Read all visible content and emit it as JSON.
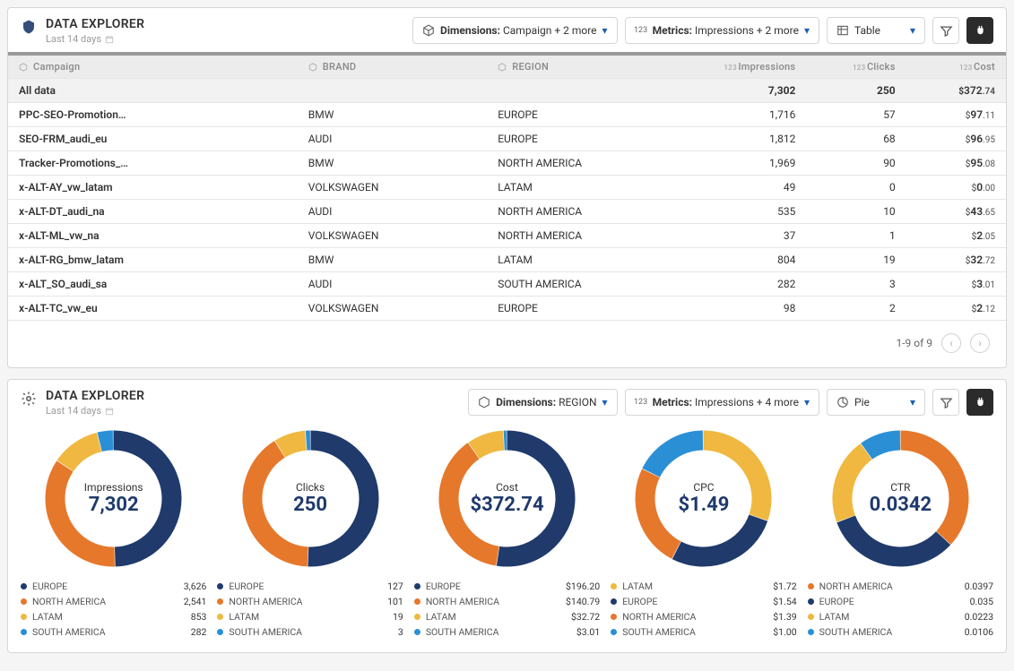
{
  "colors": {
    "europe": "#1f3a6b",
    "northamerica": "#e6782b",
    "latam": "#f0b840",
    "southamerica": "#2b8fd6"
  },
  "table": {
    "title": "DATA EXPLORER",
    "subtitle": "Last 14 days",
    "controls": {
      "dimensions_label": "Dimensions:",
      "dimensions_value": "Campaign + 2 more",
      "metrics_label": "Metrics:",
      "metrics_value": "Impressions + 2 more",
      "view": "Table"
    },
    "columns": [
      "Campaign",
      "BRAND",
      "REGION",
      "Impressions",
      "Clicks",
      "Cost"
    ],
    "totalRow": {
      "label": "All data",
      "impressions": "7,302",
      "clicks": "250",
      "cost_prefix": "$",
      "cost_major": "372",
      "cost_minor": ".74"
    },
    "rows": [
      {
        "campaign": "PPC-SEO-Promotion…",
        "brand": "BMW",
        "region": "EUROPE",
        "impressions": "1,716",
        "clicks": "57",
        "cost_major": "97",
        "cost_minor": ".11"
      },
      {
        "campaign": "SEO-FRM_audi_eu",
        "brand": "AUDI",
        "region": "EUROPE",
        "impressions": "1,812",
        "clicks": "68",
        "cost_major": "96",
        "cost_minor": ".95"
      },
      {
        "campaign": "Tracker-Promotions_…",
        "brand": "BMW",
        "region": "NORTH AMERICA",
        "impressions": "1,969",
        "clicks": "90",
        "cost_major": "95",
        "cost_minor": ".08"
      },
      {
        "campaign": "x-ALT-AY_vw_latam",
        "brand": "VOLKSWAGEN",
        "region": "LATAM",
        "impressions": "49",
        "clicks": "0",
        "cost_major": "0",
        "cost_minor": ".00"
      },
      {
        "campaign": "x-ALT-DT_audi_na",
        "brand": "AUDI",
        "region": "NORTH AMERICA",
        "impressions": "535",
        "clicks": "10",
        "cost_major": "43",
        "cost_minor": ".65"
      },
      {
        "campaign": "x-ALT-ML_vw_na",
        "brand": "VOLKSWAGEN",
        "region": "NORTH AMERICA",
        "impressions": "37",
        "clicks": "1",
        "cost_major": "2",
        "cost_minor": ".05"
      },
      {
        "campaign": "x-ALT-RG_bmw_latam",
        "brand": "BMW",
        "region": "LATAM",
        "impressions": "804",
        "clicks": "19",
        "cost_major": "32",
        "cost_minor": ".72"
      },
      {
        "campaign": "x-ALT_SO_audi_sa",
        "brand": "AUDI",
        "region": "SOUTH AMERICA",
        "impressions": "282",
        "clicks": "3",
        "cost_major": "3",
        "cost_minor": ".01"
      },
      {
        "campaign": "x-ALT-TC_vw_eu",
        "brand": "VOLKSWAGEN",
        "region": "EUROPE",
        "impressions": "98",
        "clicks": "2",
        "cost_major": "2",
        "cost_minor": ".12"
      }
    ],
    "pager": "1-9 of 9"
  },
  "charts": {
    "title": "DATA EXPLORER",
    "subtitle": "Last 14 days",
    "controls": {
      "dimensions_label": "Dimensions:",
      "dimensions_value": "REGION",
      "metrics_label": "Metrics:",
      "metrics_value": "Impressions + 4 more",
      "view": "Pie"
    },
    "donuts": [
      {
        "label": "Impressions",
        "value": "7,302",
        "sep": ",",
        "legend": [
          {
            "name": "EUROPE",
            "val": "3,626",
            "color": "europe"
          },
          {
            "name": "NORTH AMERICA",
            "val": "2,541",
            "color": "northamerica"
          },
          {
            "name": "LATAM",
            "val": "853",
            "color": "latam"
          },
          {
            "name": "SOUTH AMERICA",
            "val": "282",
            "color": "southamerica"
          }
        ],
        "slices": [
          {
            "color": "europe",
            "pct": 49.7
          },
          {
            "color": "northamerica",
            "pct": 34.8
          },
          {
            "color": "latam",
            "pct": 11.7
          },
          {
            "color": "southamerica",
            "pct": 3.8
          }
        ]
      },
      {
        "label": "Clicks",
        "value": "250",
        "legend": [
          {
            "name": "EUROPE",
            "val": "127",
            "color": "europe"
          },
          {
            "name": "NORTH AMERICA",
            "val": "101",
            "color": "northamerica"
          },
          {
            "name": "LATAM",
            "val": "19",
            "color": "latam"
          },
          {
            "name": "SOUTH AMERICA",
            "val": "3",
            "color": "southamerica"
          }
        ],
        "slices": [
          {
            "color": "europe",
            "pct": 50.8
          },
          {
            "color": "northamerica",
            "pct": 40.4
          },
          {
            "color": "latam",
            "pct": 7.6
          },
          {
            "color": "southamerica",
            "pct": 1.2
          }
        ]
      },
      {
        "label": "Cost",
        "value": "$372.74",
        "legend": [
          {
            "name": "EUROPE",
            "val": "$196.20",
            "color": "europe"
          },
          {
            "name": "NORTH AMERICA",
            "val": "$140.79",
            "color": "northamerica"
          },
          {
            "name": "LATAM",
            "val": "$32.72",
            "color": "latam"
          },
          {
            "name": "SOUTH AMERICA",
            "val": "$3.01",
            "color": "southamerica"
          }
        ],
        "slices": [
          {
            "color": "europe",
            "pct": 52.6
          },
          {
            "color": "northamerica",
            "pct": 37.8
          },
          {
            "color": "latam",
            "pct": 8.8
          },
          {
            "color": "southamerica",
            "pct": 0.8
          }
        ]
      },
      {
        "label": "CPC",
        "value": "$1.49",
        "legend": [
          {
            "name": "LATAM",
            "val": "$1.72",
            "color": "latam"
          },
          {
            "name": "EUROPE",
            "val": "$1.54",
            "color": "europe"
          },
          {
            "name": "NORTH AMERICA",
            "val": "$1.39",
            "color": "northamerica"
          },
          {
            "name": "SOUTH AMERICA",
            "val": "$1.00",
            "color": "southamerica"
          }
        ],
        "slices": [
          {
            "color": "latam",
            "pct": 30.4
          },
          {
            "color": "europe",
            "pct": 27.3
          },
          {
            "color": "northamerica",
            "pct": 24.6
          },
          {
            "color": "southamerica",
            "pct": 17.7
          }
        ]
      },
      {
        "label": "CTR",
        "value": "0.0342",
        "legend": [
          {
            "name": "NORTH AMERICA",
            "val": "0.0397",
            "color": "northamerica"
          },
          {
            "name": "EUROPE",
            "val": "0.035",
            "color": "europe"
          },
          {
            "name": "LATAM",
            "val": "0.0223",
            "color": "latam"
          },
          {
            "name": "SOUTH AMERICA",
            "val": "0.0106",
            "color": "southamerica"
          }
        ],
        "slices": [
          {
            "color": "northamerica",
            "pct": 36.9
          },
          {
            "color": "europe",
            "pct": 32.5
          },
          {
            "color": "latam",
            "pct": 20.7
          },
          {
            "color": "southamerica",
            "pct": 9.9
          }
        ]
      }
    ]
  },
  "chart_data": [
    {
      "type": "table",
      "title": "DATA EXPLORER",
      "columns": [
        "Campaign",
        "BRAND",
        "REGION",
        "Impressions",
        "Clicks",
        "Cost"
      ],
      "rows": [
        [
          "All data",
          "",
          "",
          7302,
          250,
          372.74
        ],
        [
          "PPC-SEO-Promotion…",
          "BMW",
          "EUROPE",
          1716,
          57,
          97.11
        ],
        [
          "SEO-FRM_audi_eu",
          "AUDI",
          "EUROPE",
          1812,
          68,
          96.95
        ],
        [
          "Tracker-Promotions_…",
          "BMW",
          "NORTH AMERICA",
          1969,
          90,
          95.08
        ],
        [
          "x-ALT-AY_vw_latam",
          "VOLKSWAGEN",
          "LATAM",
          49,
          0,
          0.0
        ],
        [
          "x-ALT-DT_audi_na",
          "AUDI",
          "NORTH AMERICA",
          535,
          10,
          43.65
        ],
        [
          "x-ALT-ML_vw_na",
          "VOLKSWAGEN",
          "NORTH AMERICA",
          37,
          1,
          2.05
        ],
        [
          "x-ALT-RG_bmw_latam",
          "BMW",
          "LATAM",
          804,
          19,
          32.72
        ],
        [
          "x-ALT_SO_audi_sa",
          "AUDI",
          "SOUTH AMERICA",
          282,
          3,
          3.01
        ],
        [
          "x-ALT-TC_vw_eu",
          "VOLKSWAGEN",
          "EUROPE",
          98,
          2,
          2.12
        ]
      ]
    },
    {
      "type": "pie",
      "title": "Impressions",
      "categories": [
        "EUROPE",
        "NORTH AMERICA",
        "LATAM",
        "SOUTH AMERICA"
      ],
      "values": [
        3626,
        2541,
        853,
        282
      ],
      "total": 7302
    },
    {
      "type": "pie",
      "title": "Clicks",
      "categories": [
        "EUROPE",
        "NORTH AMERICA",
        "LATAM",
        "SOUTH AMERICA"
      ],
      "values": [
        127,
        101,
        19,
        3
      ],
      "total": 250
    },
    {
      "type": "pie",
      "title": "Cost",
      "categories": [
        "EUROPE",
        "NORTH AMERICA",
        "LATAM",
        "SOUTH AMERICA"
      ],
      "values": [
        196.2,
        140.79,
        32.72,
        3.01
      ],
      "total": 372.74
    },
    {
      "type": "pie",
      "title": "CPC",
      "categories": [
        "LATAM",
        "EUROPE",
        "NORTH AMERICA",
        "SOUTH AMERICA"
      ],
      "values": [
        1.72,
        1.54,
        1.39,
        1.0
      ],
      "total": 1.49
    },
    {
      "type": "pie",
      "title": "CTR",
      "categories": [
        "NORTH AMERICA",
        "EUROPE",
        "LATAM",
        "SOUTH AMERICA"
      ],
      "values": [
        0.0397,
        0.035,
        0.0223,
        0.0106
      ],
      "total": 0.0342
    }
  ]
}
